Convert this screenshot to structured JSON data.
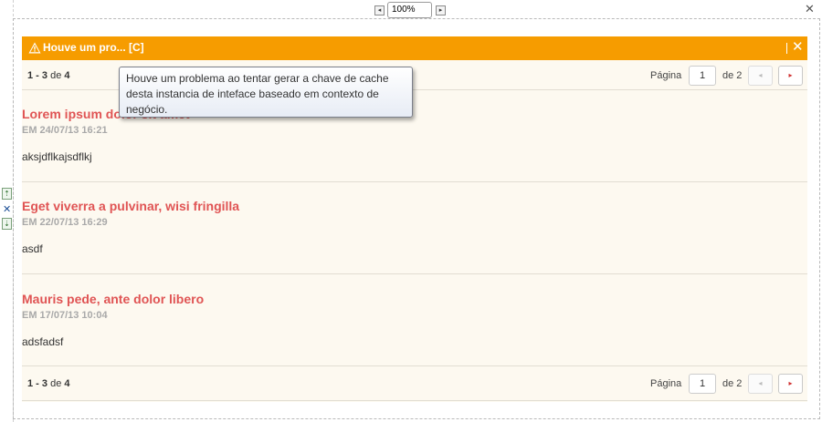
{
  "editor": {
    "zoom": "100%",
    "zoom_out_icon": "◂",
    "zoom_in_icon": "▸",
    "close_icon": "✕",
    "move_up_icon": "⇡",
    "remove_icon": "✕",
    "move_down_icon": "⇣"
  },
  "widget": {
    "title": "Houve um pro... [C]",
    "close_icon": "✕",
    "pager_top": {
      "range_start": "1",
      "range_sep": " - ",
      "range_end": "3",
      "of": " de ",
      "total": "4",
      "page_label": "Página",
      "page_value": "1",
      "of_pages": "de 2",
      "prev_icon": "◂",
      "next_icon": "▸"
    },
    "pager_bottom": {
      "range_start": "1",
      "range_sep": " - ",
      "range_end": "3",
      "of": " de ",
      "total": "4",
      "page_label": "Página",
      "page_value": "1",
      "of_pages": "de 2",
      "prev_icon": "◂",
      "next_icon": "▸"
    },
    "items": [
      {
        "title": "Lorem ipsum dolor sit amet",
        "date": "EM 24/07/13 16:21",
        "body": "aksjdflkajsdflkj"
      },
      {
        "title": "Eget viverra a pulvinar, wisi fringilla",
        "date": "EM 22/07/13 16:29",
        "body": "asdf"
      },
      {
        "title": "Mauris pede, ante dolor libero",
        "date": "EM 17/07/13 10:04",
        "body": "adsfadsf"
      }
    ]
  },
  "tooltip": {
    "text": "Houve um problema ao tentar gerar a chave de cache desta instancia de inteface baseado em contexto de negócio."
  }
}
